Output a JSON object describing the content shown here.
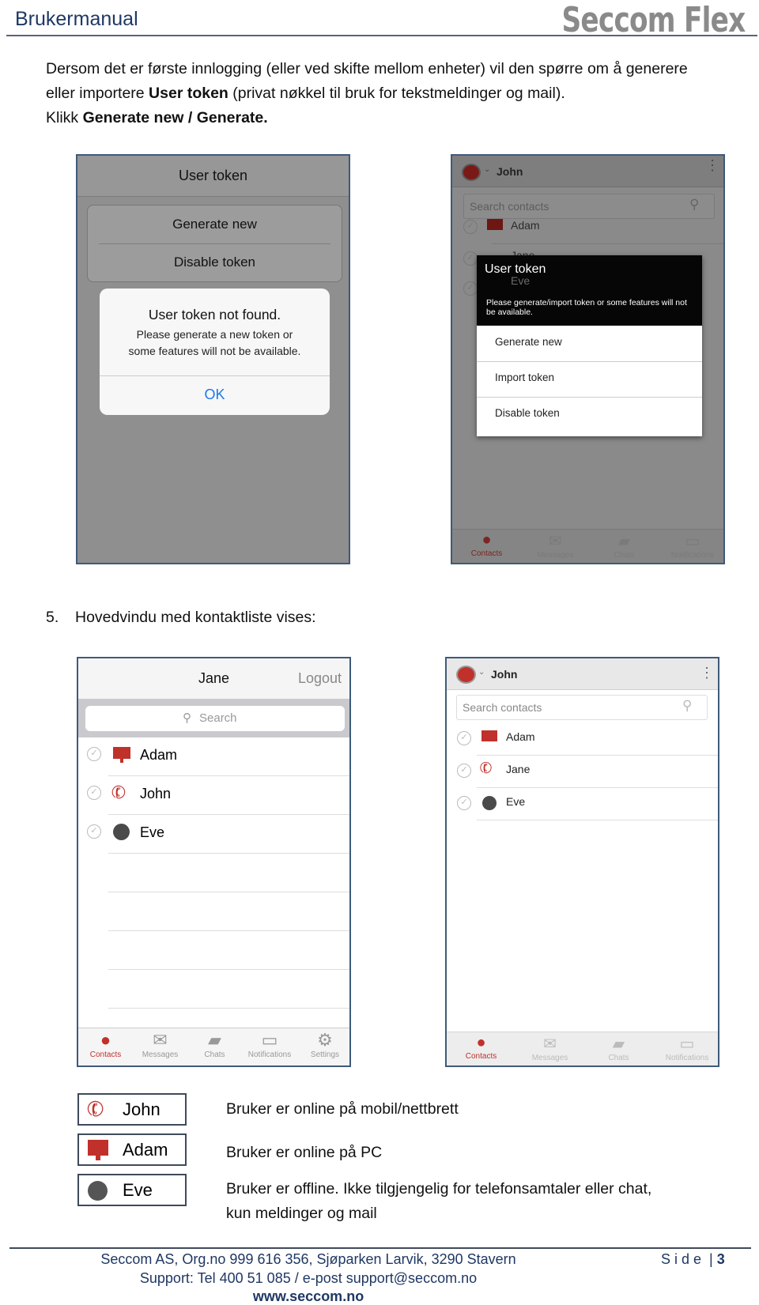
{
  "header": {
    "title": "Brukermanual",
    "logo": "Seccom Flex"
  },
  "intro": {
    "line1": "Dersom det er første innlogging (eller ved skifte mellom enheter) vil den spørre om å generere",
    "line2_pre": "eller importere ",
    "line2_bold": "User token",
    "line2_post": " (privat nøkkel til bruk for tekstmeldinger og mail).",
    "line3_pre": "Klikk ",
    "line3_bold": "Generate new / Generate."
  },
  "ios_token": {
    "title": "User token",
    "sheet": [
      "Generate new",
      "Disable token"
    ],
    "alert_title": "User token not found.",
    "alert_msg1": "Please generate a new token or",
    "alert_msg2": "some features will not be available.",
    "alert_ok": "OK"
  },
  "android_token": {
    "user": "John",
    "search_placeholder": "Search contacts",
    "contacts": [
      "Adam",
      "Jane",
      "Eve"
    ],
    "dialog_title": "User token",
    "dialog_msg": "Please generate/import token or some features will not be available.",
    "items": [
      "Generate new",
      "Import token",
      "Disable token"
    ],
    "tabs": [
      "Contacts",
      "Messages",
      "Chats",
      "Notifications"
    ]
  },
  "step5": {
    "num": "5.",
    "text": "Hovedvindu med kontaktliste  vises:"
  },
  "ios_main": {
    "user": "Jane",
    "logout": "Logout",
    "search_placeholder": "Search",
    "contacts": [
      {
        "name": "Adam",
        "status": "pc"
      },
      {
        "name": "John",
        "status": "mobile"
      },
      {
        "name": "Eve",
        "status": "offline"
      }
    ],
    "tabs": [
      "Contacts",
      "Messages",
      "Chats",
      "Notifications",
      "Settings"
    ]
  },
  "android_main": {
    "user": "John",
    "search_placeholder": "Search contacts",
    "contacts": [
      {
        "name": "Adam",
        "status": "pc"
      },
      {
        "name": "Jane",
        "status": "mobile"
      },
      {
        "name": "Eve",
        "status": "offline"
      }
    ],
    "tabs": [
      "Contacts",
      "Messages",
      "Chats",
      "Notifications"
    ]
  },
  "legend": [
    {
      "name": "John",
      "icon": "phone-icon",
      "text": "Bruker er online på mobil/nettbrett"
    },
    {
      "name": "Adam",
      "icon": "monitor-icon",
      "text": "Bruker er online på PC"
    },
    {
      "name": "Eve",
      "icon": "offline-dot-icon",
      "text": "Bruker er offline. Ikke tilgjengelig for telefonsamtaler eller chat,",
      "text2": "kun meldinger og mail"
    }
  ],
  "footer": {
    "line1": "Seccom AS, Org.no 999 616 356, Sjøparken Larvik, 3290 Stavern",
    "line2": "Support: Tel 400 51 085 / e-post support@seccom.no",
    "line3": "www.seccom.no",
    "page_label": "S i d e  |",
    "page_num": "3"
  },
  "colors": {
    "accent": "#c0312b",
    "ios_blue": "#1a7ae8",
    "heading": "#1f3864"
  }
}
